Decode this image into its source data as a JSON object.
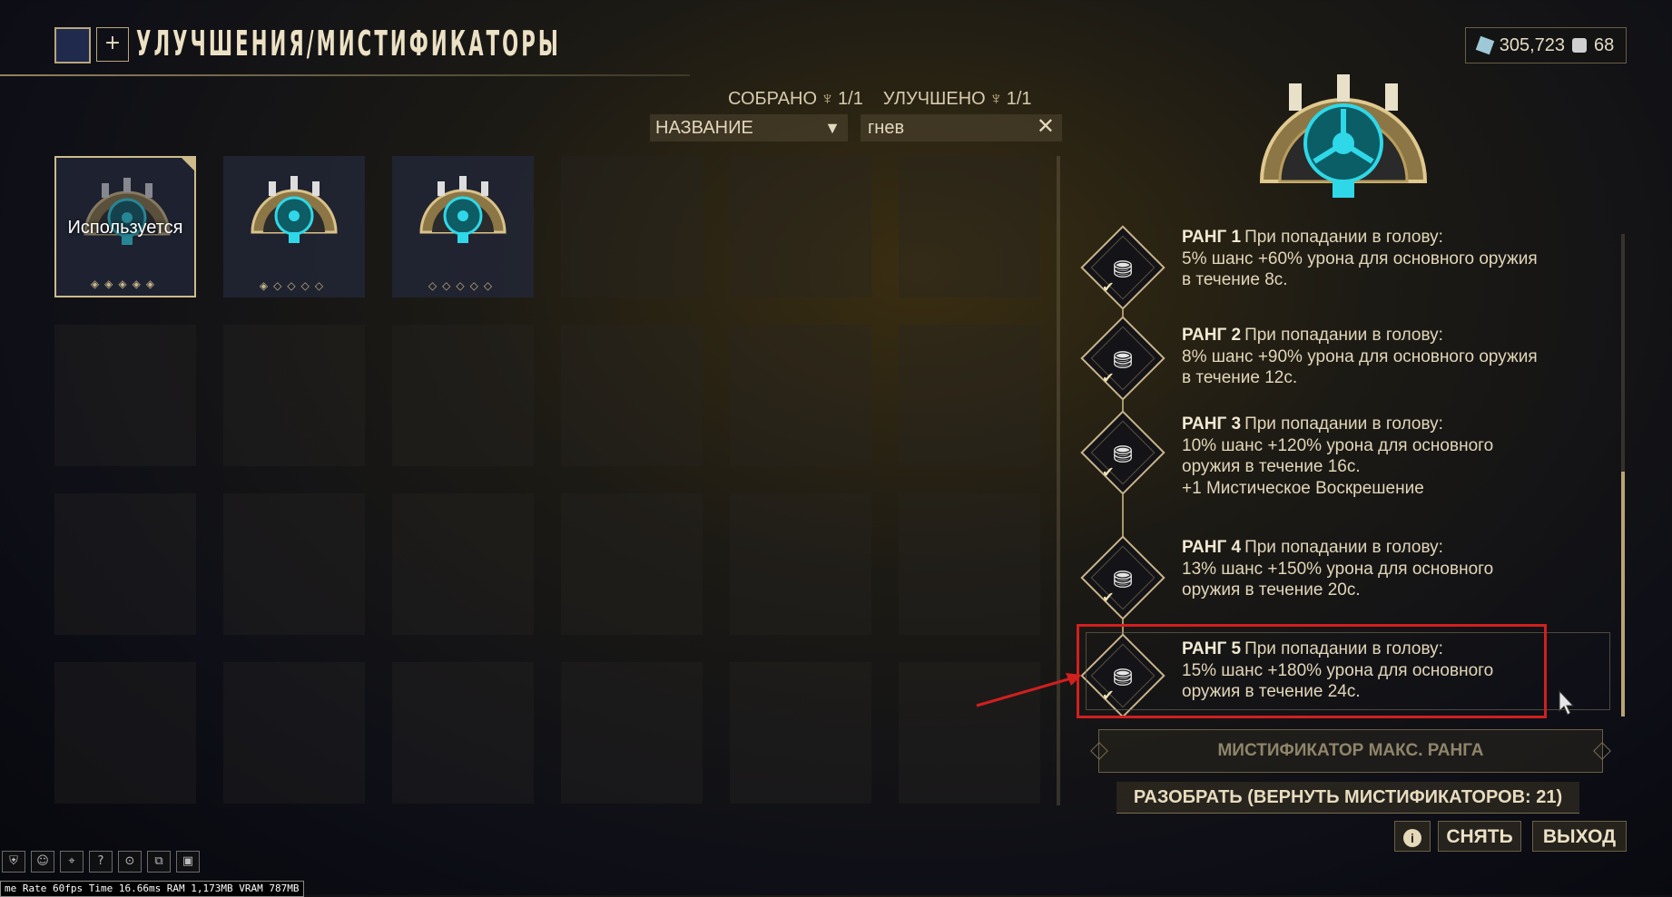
{
  "header": {
    "title": "УЛУЧШЕНИЯ/МИСТИФИКАТОРЫ",
    "plus_label": "+"
  },
  "currency": {
    "credits": "305,723",
    "endo": "68"
  },
  "stats": {
    "collected_label": "СОБРАНО",
    "collected_value": "1/1",
    "upgraded_label": "УЛУЧШЕНО",
    "upgraded_value": "1/1"
  },
  "filters": {
    "sort_value": "НАЗВАНИЕ",
    "search_value": "гнев"
  },
  "grid": {
    "items": [
      {
        "label": "Используется",
        "rank_filled": 5,
        "rank_max": 5,
        "selected": true
      },
      {
        "label": "",
        "rank_filled": 1,
        "rank_max": 5,
        "selected": false
      },
      {
        "label": "",
        "rank_filled": 0,
        "rank_max": 5,
        "selected": false
      }
    ]
  },
  "ranks": [
    {
      "title": "РАНГ 1",
      "lines": [
        "При попадании в голову:",
        "5% шанс +60% урона для основного оружия",
        "в течение 8с."
      ]
    },
    {
      "title": "РАНГ 2",
      "lines": [
        "При попадании в голову:",
        "8% шанс +90% урона для основного оружия",
        "в течение 12с."
      ]
    },
    {
      "title": "РАНГ 3",
      "lines": [
        "При попадании в голову:",
        "10% шанс +120% урона для основного",
        "оружия в течение 16с.",
        "+1 Мистическое Воскрешение"
      ]
    },
    {
      "title": "РАНГ 4",
      "lines": [
        "При попадании в голову:",
        "13% шанс +150% урона для основного",
        "оружия в течение 20с."
      ]
    },
    {
      "title": "РАНГ 5",
      "lines": [
        "При попадании в голову:",
        "15% шанс +180% урона для основного",
        "оружия в течение 24с."
      ]
    }
  ],
  "buttons": {
    "max_rank": "МИСТИФИКАТОР МАКС. РАНГА",
    "dismantle": "РАЗОБРАТЬ (ВЕРНУТЬ МИСТИФИКАТОРОВ: 21)",
    "info": "i",
    "remove": "СНЯТЬ",
    "exit": "ВЫХОД"
  },
  "perf": "me Rate 60fps Time 16.66ms RAM 1,173MB VRAM 787MB",
  "colors": {
    "accent_gold": "#c9b58a",
    "relic_cyan": "#2fd8e8",
    "highlight_red": "#d21f1f"
  }
}
